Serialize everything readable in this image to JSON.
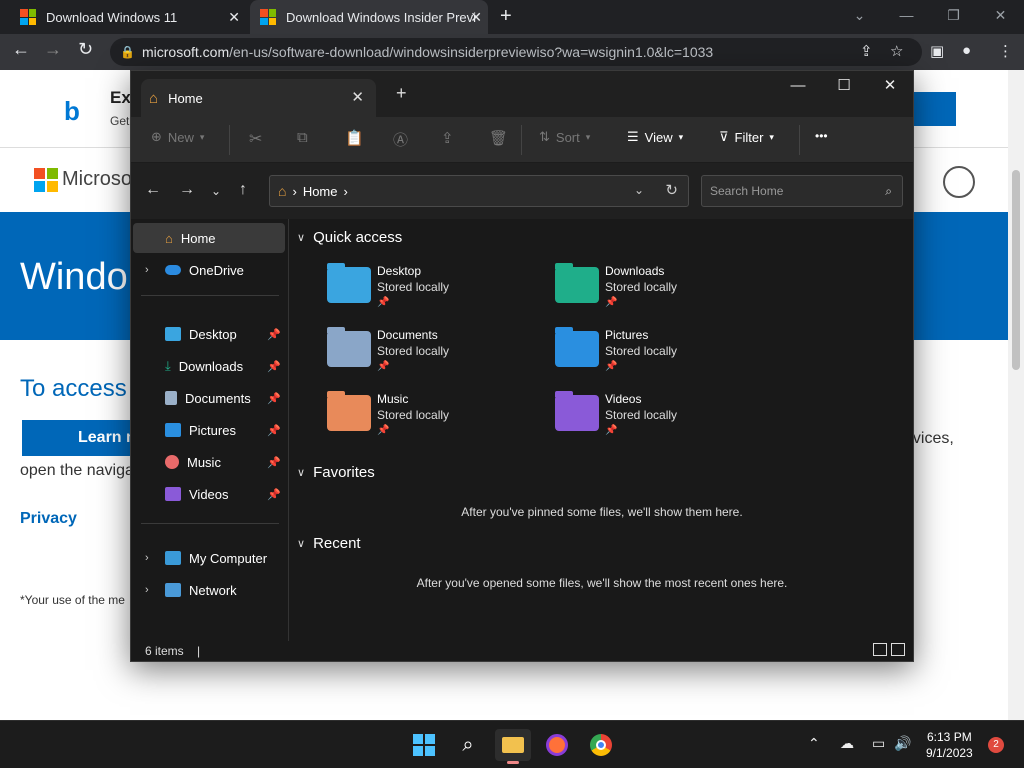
{
  "browser": {
    "tabs": [
      {
        "title": "Download Windows 11",
        "active": false
      },
      {
        "title": "Download Windows Insider Previ",
        "active": true
      }
    ],
    "url_host": "microsoft.com",
    "url_path": "/en-us/software-download/windowsinsiderpreviewiso?wa=wsignin1.0&lc=1033"
  },
  "webpage": {
    "bing_title": "Ex",
    "bing_sub": "Get",
    "brand": "Microso",
    "hero": "Windo",
    "access_heading": "To access",
    "learn_button": "Learn m",
    "open_text": "open the naviga",
    "devices_text": "evices,",
    "privacy": "Privacy",
    "footnote": "*Your use of the me"
  },
  "explorer": {
    "tab_title": "Home",
    "commands": {
      "new": "New",
      "sort": "Sort",
      "view": "View",
      "filter": "Filter",
      "more": "•••"
    },
    "address": {
      "location": "Home"
    },
    "search_placeholder": "Search Home",
    "nav": {
      "home": "Home",
      "onedrive": "OneDrive",
      "desktop": "Desktop",
      "downloads": "Downloads",
      "documents": "Documents",
      "pictures": "Pictures",
      "music": "Music",
      "videos": "Videos",
      "my_computer": "My Computer",
      "network": "Network"
    },
    "sections": {
      "quick_access": "Quick access",
      "favorites": "Favorites",
      "recent": "Recent"
    },
    "quick_access": [
      {
        "name": "Desktop",
        "status": "Stored locally",
        "color": "#3aa5e0"
      },
      {
        "name": "Downloads",
        "status": "Stored locally",
        "color": "#1fae8a"
      },
      {
        "name": "Documents",
        "status": "Stored locally",
        "color": "#8aa6c8"
      },
      {
        "name": "Pictures",
        "status": "Stored locally",
        "color": "#2a8fe0"
      },
      {
        "name": "Music",
        "status": "Stored locally",
        "color": "#e88a5a"
      },
      {
        "name": "Videos",
        "status": "Stored locally",
        "color": "#8a5ad8"
      }
    ],
    "favorites_empty": "After you've pinned some files, we'll show them here.",
    "recent_empty": "After you've opened some files, we'll show the most recent ones here.",
    "status": "6 items"
  },
  "taskbar": {
    "time": "6:13 PM",
    "date": "9/1/2023",
    "notifications": "2"
  },
  "colors": {
    "accent": "#0067b8",
    "explorer_bg": "#191919",
    "taskbar_bg": "#1c1c1c"
  }
}
